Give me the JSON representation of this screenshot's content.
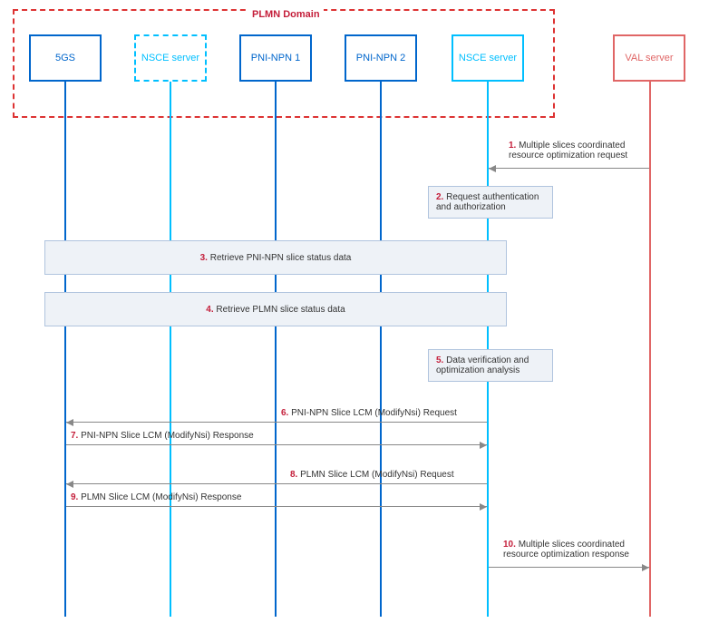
{
  "domain": {
    "plmn_label": "PLMN Domain"
  },
  "actors": {
    "a5gs": "5GS",
    "nsce1": "NSCE server",
    "pninpn1": "PNI-NPN 1",
    "pninpn2": "PNI-NPN 2",
    "nsce2": "NSCE server",
    "val": "VAL server"
  },
  "steps": {
    "s1": {
      "num": "1.",
      "text": "Multiple slices coordinated resource optimization request"
    },
    "s2": {
      "num": "2.",
      "text": "Request authentication and authorization"
    },
    "s3": {
      "num": "3.",
      "text": "Retrieve PNI-NPN slice status data"
    },
    "s4": {
      "num": "4.",
      "text": "Retrieve PLMN slice status data"
    },
    "s5": {
      "num": "5.",
      "text": "Data verification and optimization analysis"
    },
    "s6": {
      "num": "6.",
      "text": "PNI-NPN Slice LCM (ModifyNsi) Request"
    },
    "s7": {
      "num": "7.",
      "text": "PNI-NPN Slice LCM (ModifyNsi) Response"
    },
    "s8": {
      "num": "8.",
      "text": "PLMN Slice LCM (ModifyNsi) Request"
    },
    "s9": {
      "num": "9.",
      "text": "PLMN Slice LCM (ModifyNsi) Response"
    },
    "s10": {
      "num": "10.",
      "text": "Multiple slices coordinated resource optimization response"
    }
  }
}
